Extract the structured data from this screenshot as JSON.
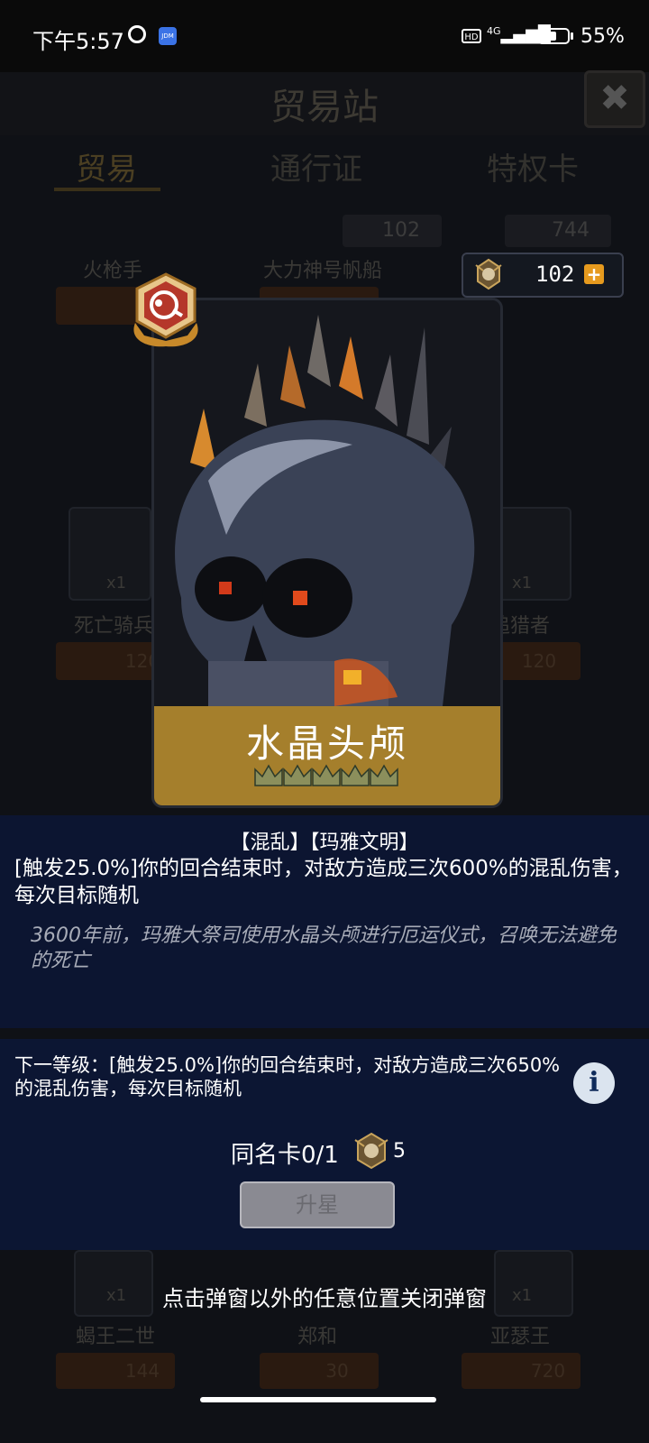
{
  "status_bar": {
    "time": "下午5:57",
    "jdm_label": "JDM",
    "hd_label": "HD",
    "signal_label": "4G",
    "battery": "55%"
  },
  "screen": {
    "title": "贸易站",
    "tabs": [
      "贸易",
      "通行证",
      "特权卡"
    ],
    "resources": [
      "102",
      "744"
    ],
    "shop_items_row1": [
      "火枪手",
      "大力神号帆船"
    ],
    "shop_items_row2": [
      "死亡骑兵",
      "追猎者"
    ],
    "shop_items_row2_prices": [
      "120",
      "120"
    ],
    "shop_items_row3": [
      "蝎王二世",
      "郑和",
      "亚瑟王"
    ],
    "shop_items_row3_prices": [
      "144",
      "30",
      "720"
    ],
    "multiplier": "x1"
  },
  "currency_chip": {
    "value": "102",
    "plus": "+"
  },
  "card": {
    "name": "水晶头颅"
  },
  "details": {
    "tags": "【混乱】【玛雅文明】",
    "effect": "[触发25.0%]你的回合结束时，对敌方造成三次600%的混乱伤害，每次目标随机",
    "lore": "3600年前，玛雅大祭司使用水晶头颅进行厄运仪式，召唤无法避免的死亡"
  },
  "upgrade": {
    "next_level": "下一等级：[触发25.0%]你的回合结束时，对敌方造成三次650%的混乱伤害，每次目标随机",
    "same_card": "同名卡0/1",
    "cost": "5",
    "button": "升星"
  },
  "hint": "点击弹窗以外的任意位置关闭弹窗",
  "icons": {
    "close": "close-icon",
    "info": "info-icon",
    "medal": "medal-icon",
    "alarm": "alarm-icon"
  },
  "colors": {
    "panel": "#0c1633",
    "banner": "#a57f2c",
    "accent": "#e69a1e"
  }
}
